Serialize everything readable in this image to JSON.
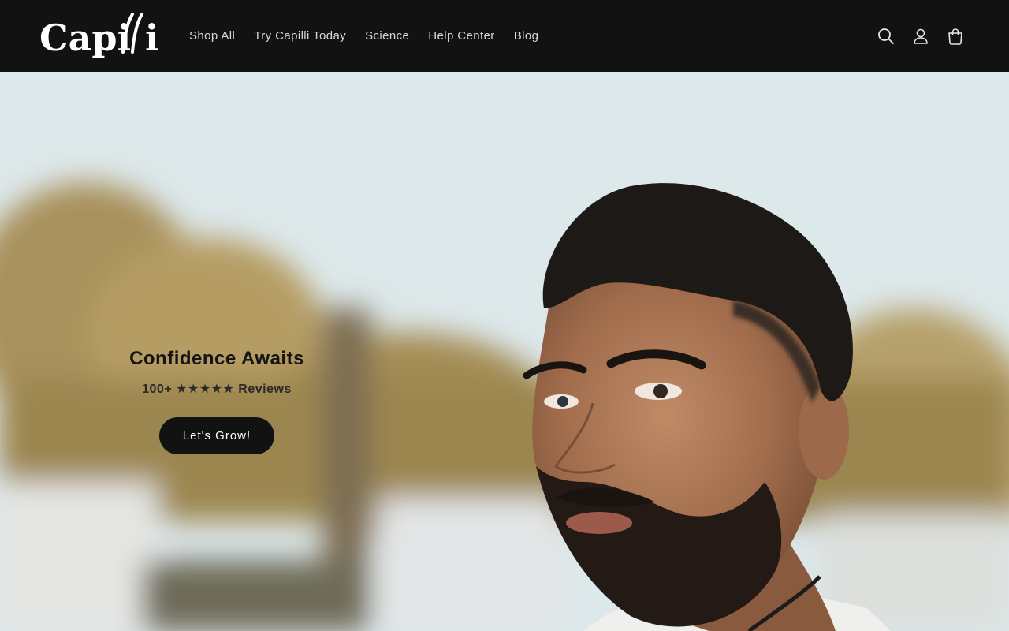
{
  "header": {
    "logo_text": "Capilli",
    "nav": [
      {
        "label": "Shop All"
      },
      {
        "label": "Try Capilli Today"
      },
      {
        "label": "Science"
      },
      {
        "label": "Help Center"
      },
      {
        "label": "Blog"
      }
    ],
    "icons": [
      "search-icon",
      "account-icon",
      "cart-icon"
    ]
  },
  "hero": {
    "title": "Confidence Awaits",
    "reviews": "100+ ★★★★★ Reviews",
    "button_label": "Let's Grow!"
  },
  "colors": {
    "header_bg": "#121212",
    "nav_text": "#d7d7d7",
    "button_bg": "#121212",
    "button_text": "#ffffff"
  }
}
